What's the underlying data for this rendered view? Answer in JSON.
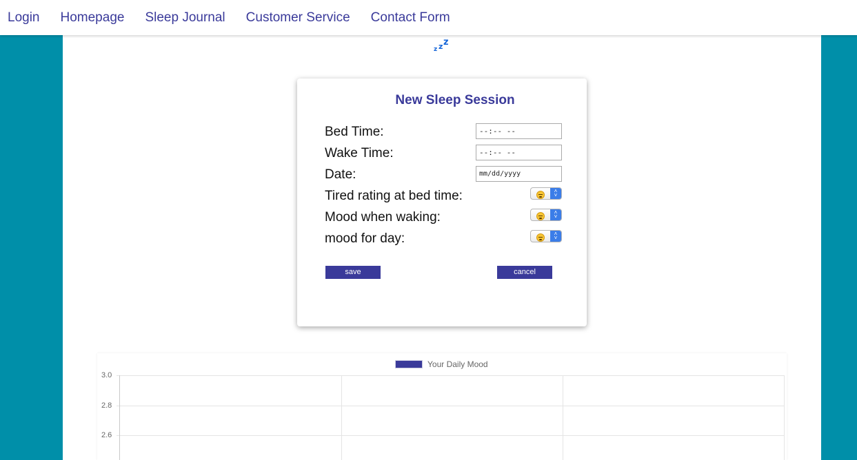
{
  "nav": {
    "items": [
      {
        "label": "Login"
      },
      {
        "label": "Homepage"
      },
      {
        "label": "Sleep Journal"
      },
      {
        "label": "Customer Service"
      },
      {
        "label": "Contact Form"
      }
    ]
  },
  "logo": {
    "icon": "sleep-zzz-icon",
    "color": "#1565d8"
  },
  "form": {
    "title": "New Sleep Session",
    "bed_time": {
      "label": "Bed Time:",
      "value": "--:-- --"
    },
    "wake_time": {
      "label": "Wake Time:",
      "value": "--:-- --"
    },
    "date": {
      "label": "Date:",
      "value": "mm/dd/yyyy"
    },
    "tired_rating": {
      "label": "Tired rating at bed time:",
      "selected_icon": "crying-face-emoji"
    },
    "mood_waking": {
      "label": "Mood when waking:",
      "selected_icon": "crying-face-emoji"
    },
    "mood_day": {
      "label": "mood for day:",
      "selected_icon": "crying-face-emoji"
    },
    "save_label": "save",
    "cancel_label": "cancel"
  },
  "colors": {
    "background": "#008fa9",
    "accent": "#3a3a9a",
    "select_arrow": "#3b7de8"
  },
  "chart_data": {
    "type": "line",
    "title": "",
    "series": [
      {
        "name": "Your Daily Mood",
        "values": []
      }
    ],
    "y_ticks": [
      "3.0",
      "2.8",
      "2.6"
    ],
    "ylim": [
      2.6,
      3.0
    ],
    "grid": true,
    "legend": "top-center"
  }
}
